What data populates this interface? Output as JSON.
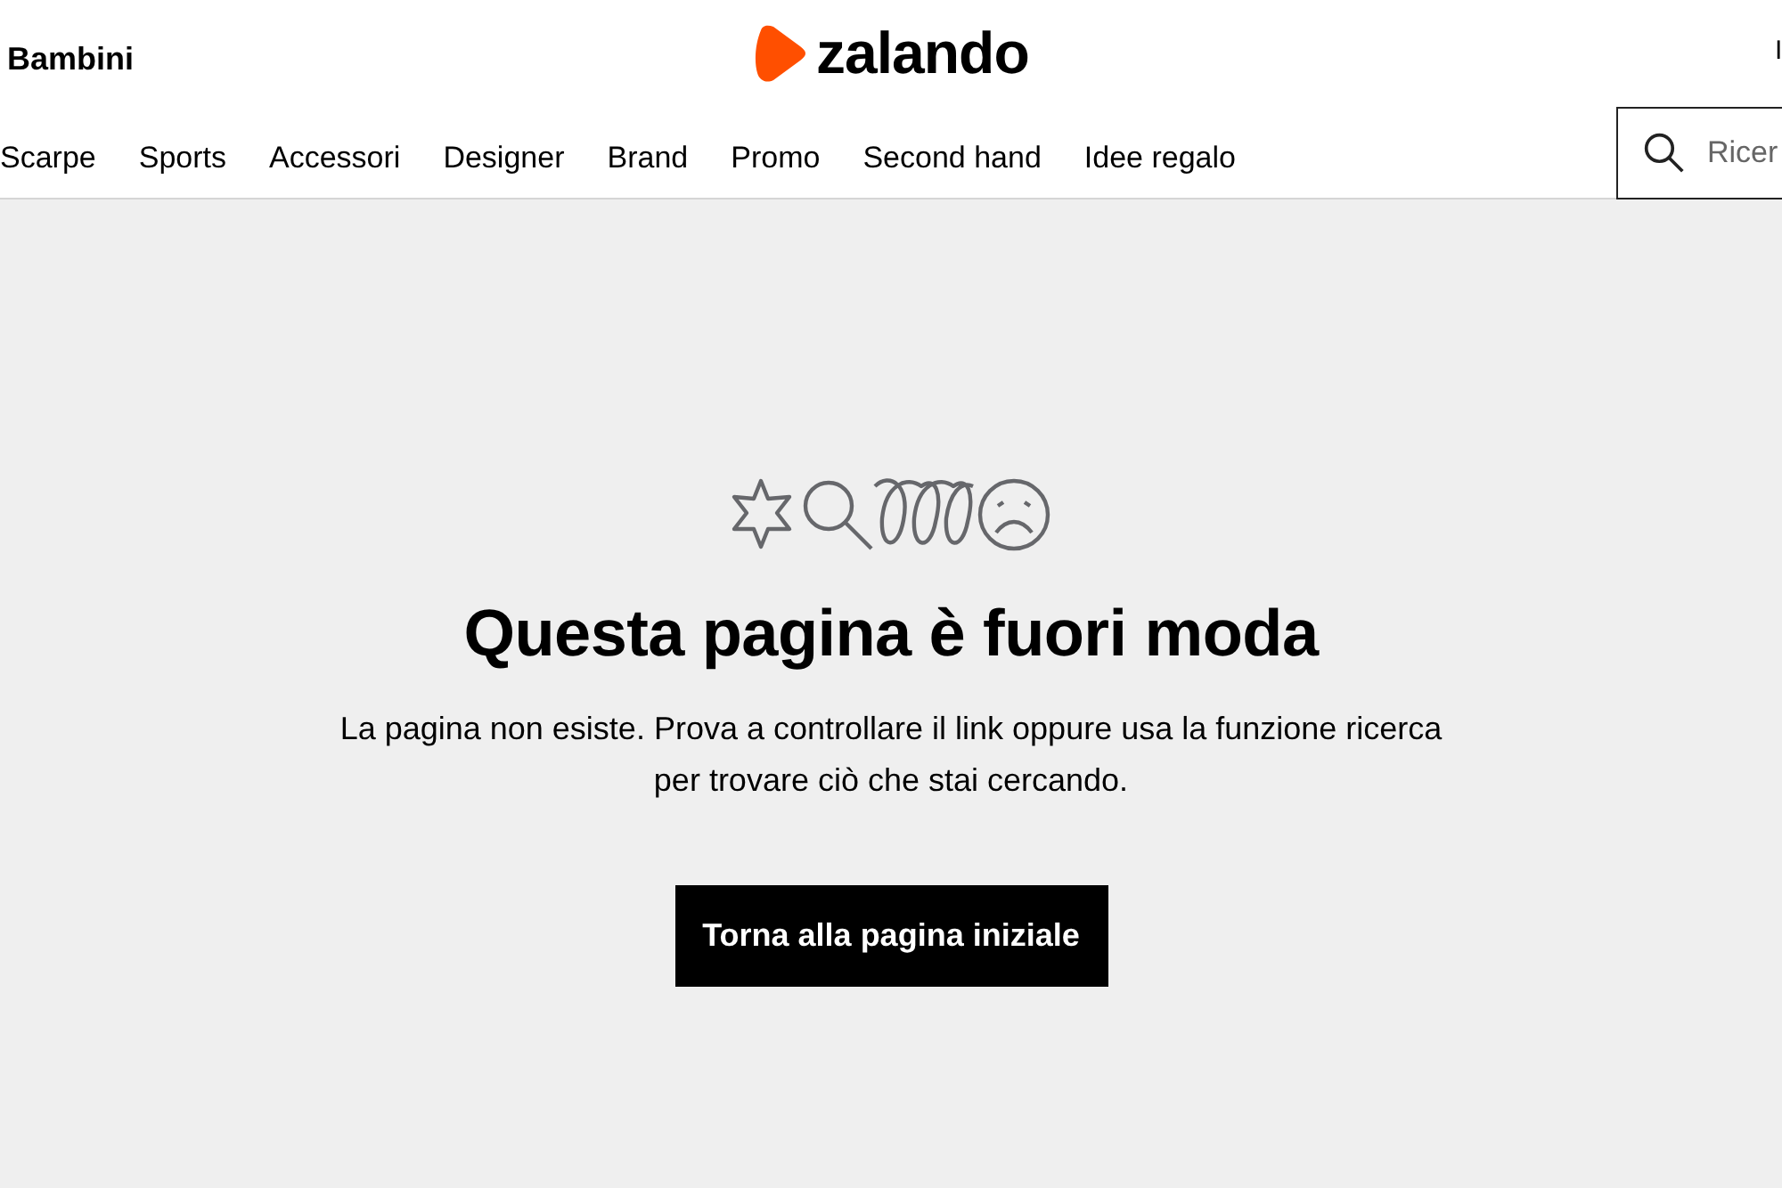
{
  "header": {
    "category": "Bambini",
    "logo": "zalando",
    "language": "I"
  },
  "nav": [
    "Scarpe",
    "Sports",
    "Accessori",
    "Designer",
    "Brand",
    "Promo",
    "Second hand",
    "Idee regalo"
  ],
  "search": {
    "placeholder": "Ricer"
  },
  "error": {
    "title": "Questa pagina è fuori moda",
    "message": "La pagina non esiste. Prova a controllare il link oppure usa la funzione ricerca per trovare ciò che stai cercando.",
    "button": "Torna alla pagina iniziale"
  }
}
